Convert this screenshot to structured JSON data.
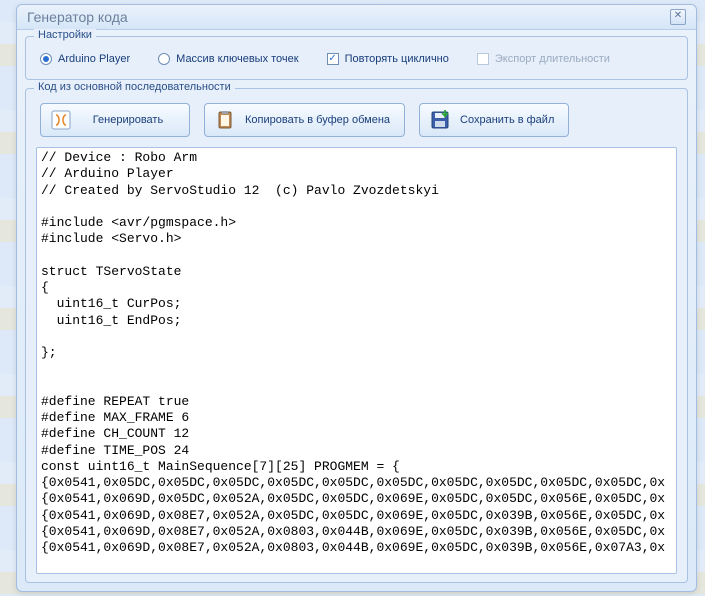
{
  "dialog": {
    "title": "Генератор кода"
  },
  "settings": {
    "legend": "Настройки",
    "radio_arduino": "Arduino Player",
    "radio_keypoints": "Массив ключевых точек",
    "check_repeat": "Повторять циклично",
    "check_export": "Экспорт длительности"
  },
  "codegroup": {
    "legend": "Код из основной последовательности",
    "btn_generate": "Генерировать",
    "btn_copy": "Копировать в\nбуфер обмена",
    "btn_save": "Сохранить в файл"
  },
  "code": "// Device : Robo Arm\n// Arduino Player\n// Created by ServoStudio 12  (c) Pavlo Zvozdetskyi\n\n#include <avr/pgmspace.h>\n#include <Servo.h>\n\nstruct TServoState\n{\n  uint16_t CurPos;\n  uint16_t EndPos;\n\n};\n\n\n#define REPEAT true\n#define MAX_FRAME 6\n#define CH_COUNT 12\n#define TIME_POS 24\nconst uint16_t MainSequence[7][25] PROGMEM = {\n{0x0541,0x05DC,0x05DC,0x05DC,0x05DC,0x05DC,0x05DC,0x05DC,0x05DC,0x05DC,0x05DC,0x\n{0x0541,0x069D,0x05DC,0x052A,0x05DC,0x05DC,0x069E,0x05DC,0x05DC,0x056E,0x05DC,0x\n{0x0541,0x069D,0x08E7,0x052A,0x05DC,0x05DC,0x069E,0x05DC,0x039B,0x056E,0x05DC,0x\n{0x0541,0x069D,0x08E7,0x052A,0x0803,0x044B,0x069E,0x05DC,0x039B,0x056E,0x05DC,0x\n{0x0541,0x069D,0x08E7,0x052A,0x0803,0x044B,0x069E,0x05DC,0x039B,0x056E,0x07A3,0x"
}
